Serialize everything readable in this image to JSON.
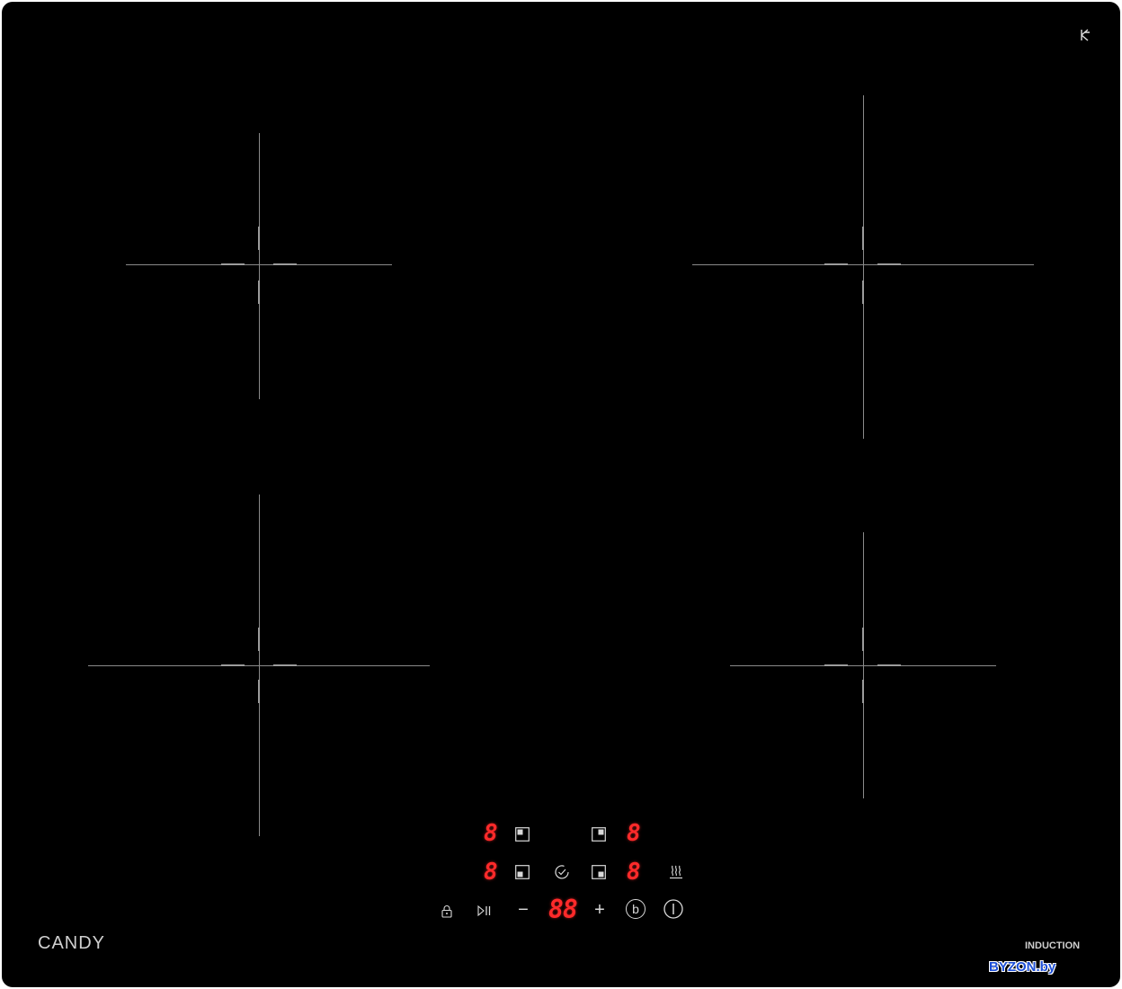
{
  "brand": {
    "logo_text": "CANDY",
    "type_label": "INDUCTION"
  },
  "watermark": "BYZON.by",
  "colors": {
    "glass": "#000000",
    "display_red": "#ff2a2a",
    "marking": "#8a8a8a",
    "watermark_blue": "#1d4fd6"
  },
  "displays": {
    "rear_left_level": "8",
    "rear_right_level": "8",
    "front_left_level": "8",
    "front_right_level": "8",
    "timer": "88"
  },
  "controls": {
    "minus": "−",
    "plus": "+",
    "boost": "b"
  },
  "icons": {
    "lock": "lock-icon",
    "play_pause": "play-pause-icon",
    "timer_check": "timer-check-icon",
    "keep_warm": "keep-warm-icon",
    "power": "power-icon",
    "corner": "hob-to-hood-icon"
  }
}
